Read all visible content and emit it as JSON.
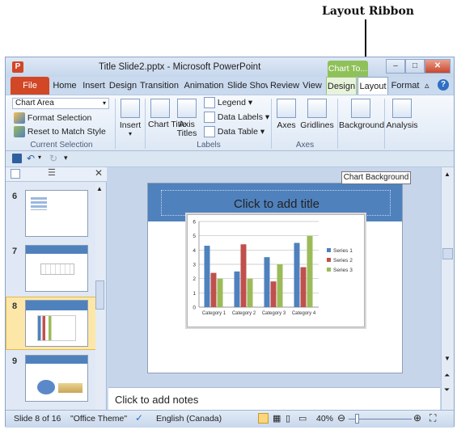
{
  "annotation": {
    "label": "Layout Ribbon"
  },
  "window": {
    "app_icon": "P",
    "title": "Title Slide2.pptx - Microsoft PowerPoint",
    "contextual_tab_group": "Chart To..."
  },
  "tabs": [
    "File",
    "Home",
    "Insert",
    "Design",
    "Transition",
    "Animation",
    "Slide Show",
    "Review",
    "View",
    "Design",
    "Layout",
    "Format"
  ],
  "ribbon": {
    "current_selection": {
      "dropdown_value": "Chart Area",
      "format_selection": "Format Selection",
      "reset_to_match_style": "Reset to Match Style",
      "group_label": "Current Selection"
    },
    "insert": {
      "label": "Insert"
    },
    "labels": {
      "chart_title": "Chart Title",
      "axis_titles": "Axis Titles",
      "legend": "Legend",
      "data_labels": "Data Labels",
      "data_table": "Data Table",
      "group_label": "Labels"
    },
    "axes": {
      "axes": "Axes",
      "gridlines": "Gridlines",
      "group_label": "Axes"
    },
    "background": {
      "label": "Background"
    },
    "analysis": {
      "label": "Analysis"
    }
  },
  "tooltip": "Chart Background",
  "thumbnails": [
    "6",
    "7",
    "8",
    "9"
  ],
  "slide": {
    "title_placeholder": "Click to add title"
  },
  "notes_placeholder": "Click to add notes",
  "status": {
    "slide_info": "Slide 8 of 16",
    "theme": "\"Office Theme\"",
    "language": "English (Canada)",
    "zoom": "40%"
  },
  "chart_data": {
    "type": "bar",
    "categories": [
      "Category 1",
      "Category 2",
      "Category 3",
      "Category 4"
    ],
    "series": [
      {
        "name": "Series 1",
        "color": "#4f81bd",
        "values": [
          4.3,
          2.5,
          3.5,
          4.5
        ]
      },
      {
        "name": "Series 2",
        "color": "#c0504d",
        "values": [
          2.4,
          4.4,
          1.8,
          2.8
        ]
      },
      {
        "name": "Series 3",
        "color": "#9bbb59",
        "values": [
          2,
          2,
          3,
          5
        ]
      }
    ],
    "ylim": [
      0,
      6
    ],
    "yticks": [
      "0",
      "1",
      "2",
      "3",
      "4",
      "5",
      "6"
    ],
    "grid": true,
    "legend": "right"
  }
}
